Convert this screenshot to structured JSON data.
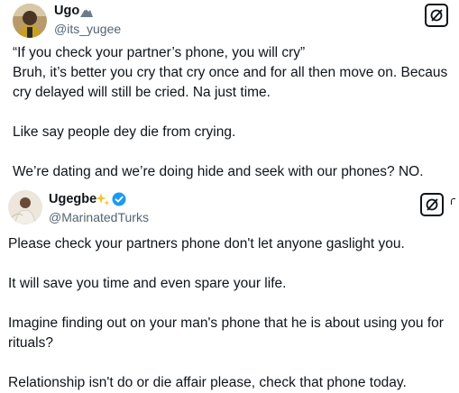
{
  "tweets": [
    {
      "display_name": "Ugo",
      "name_emoji": "mountain-emoji",
      "handle": "@its_yugee",
      "lines": [
        "“If you check your partner’s phone, you will cry”",
        "Bruh, it’s better you cry that cry once and for all then move on. Becaus",
        "cry delayed will still be cried. Na just time.",
        "",
        "Like say people dey die from crying.",
        "",
        "We’re dating and we’re doing hide and seek with our phones? NO."
      ]
    },
    {
      "display_name": "Ugegbe",
      "name_emoji": "sparkles-emoji",
      "verified": true,
      "handle": "@MarinatedTurks",
      "lines": [
        "Please check your partners phone don't let anyone gaslight you.",
        "",
        "It will save you time and even spare your life.",
        "",
        "Imagine finding out on your man's phone that he is about using you for",
        "rituals?",
        "",
        "Relationship isn't do or die affair please, check that phone today."
      ]
    }
  ],
  "colors": {
    "text": "#0f1419",
    "secondary": "#536471",
    "verified": "#1d9bf0",
    "sparkle": "#f4c430"
  }
}
